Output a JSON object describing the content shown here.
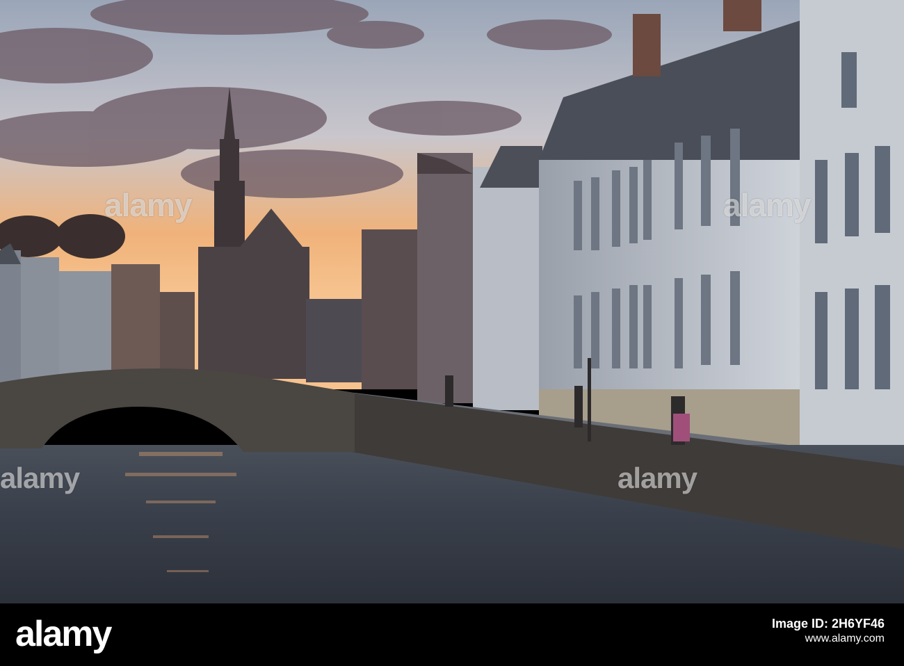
{
  "scene": {
    "description_colors": {
      "sky_top": "#a8b4c4",
      "sunset": "#f2a56b",
      "clouds": "#5b4a57",
      "water": "#3d4450",
      "facade": "#c9ced6"
    }
  },
  "watermark": {
    "text": "alamy"
  },
  "footer": {
    "logo": "alamy",
    "image_id_label": "Image ID: 2H6YF46",
    "site": "www.alamy.com"
  }
}
